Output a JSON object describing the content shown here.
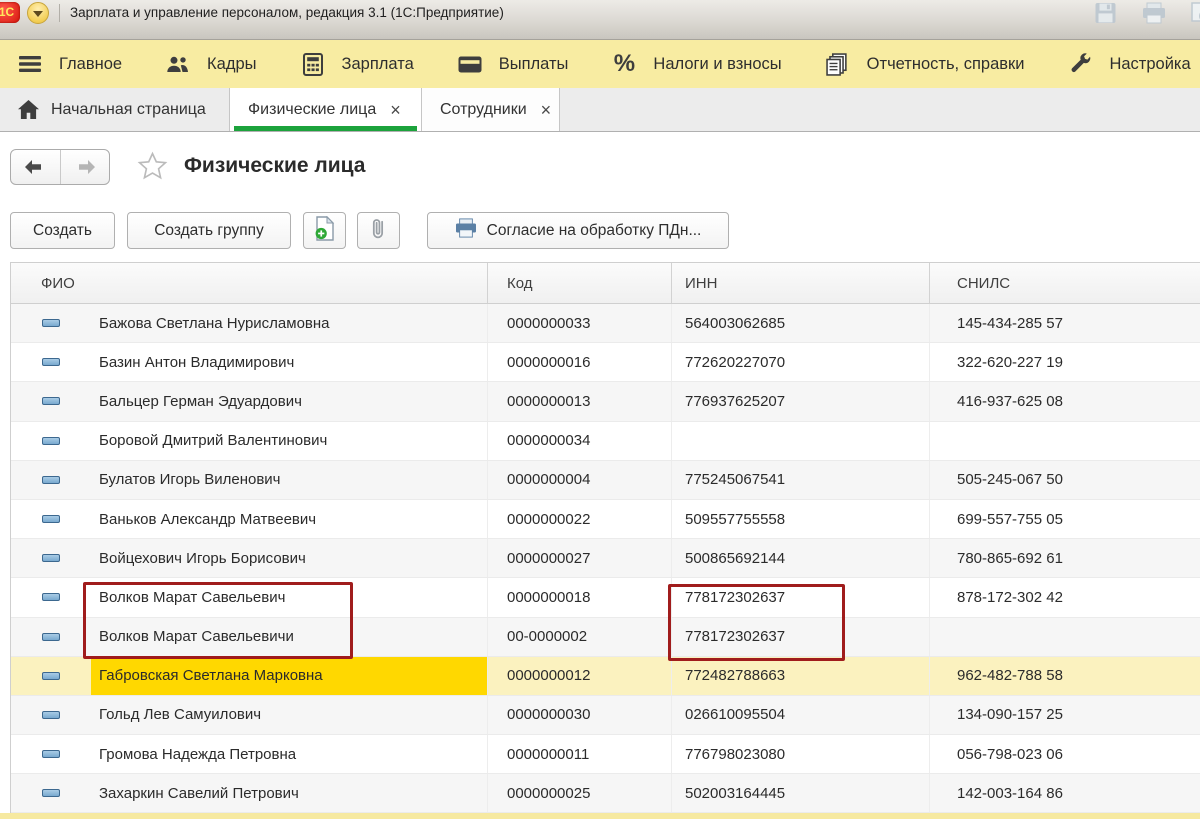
{
  "titlebar": {
    "logo": "1С",
    "title": "Зарплата и управление персоналом, редакция 3.1  (1С:Предприятие)",
    "window_icons": [
      "save-icon",
      "print-icon",
      "print-preview-icon"
    ]
  },
  "menu": {
    "items": [
      {
        "label": "Главное",
        "icon": "hamburger-icon"
      },
      {
        "label": "Кадры",
        "icon": "people-icon"
      },
      {
        "label": "Зарплата",
        "icon": "calculator-icon"
      },
      {
        "label": "Выплаты",
        "icon": "card-icon"
      },
      {
        "label": "Налоги и взносы",
        "icon": "percent-icon"
      },
      {
        "label": "Отчетность, справки",
        "icon": "report-icon"
      },
      {
        "label": "Настройка",
        "icon": "wrench-icon"
      }
    ]
  },
  "tabs": [
    {
      "label": "Начальная страница",
      "icon": "home-icon",
      "closable": false,
      "active": false
    },
    {
      "label": "Физические лица",
      "icon": null,
      "closable": true,
      "active": true
    },
    {
      "label": "Сотрудники",
      "icon": null,
      "closable": true,
      "active": false
    }
  ],
  "ui": {
    "close_glyph": "×"
  },
  "page": {
    "title": "Физические лица"
  },
  "toolbar": {
    "create_label": "Создать",
    "create_group_label": "Создать группу",
    "doc_plus_icon": "document-add-icon",
    "paperclip_icon": "paperclip-icon",
    "consent_label": "Согласие на обработку ПДн...",
    "consent_icon": "printer-icon"
  },
  "table": {
    "columns": [
      "ФИО",
      "Код",
      "ИНН",
      "СНИЛС"
    ],
    "rows": [
      {
        "fio": "Бажова Светлана Нурисламовна",
        "code": "0000000033",
        "inn": "564003062685",
        "snils": "145-434-285 57",
        "selected": false
      },
      {
        "fio": "Базин Антон Владимирович",
        "code": "0000000016",
        "inn": "772620227070",
        "snils": "322-620-227 19",
        "selected": false
      },
      {
        "fio": "Бальцер Герман Эдуардович",
        "code": "0000000013",
        "inn": "776937625207",
        "snils": "416-937-625 08",
        "selected": false
      },
      {
        "fio": "Боровой Дмитрий Валентинович",
        "code": "0000000034",
        "inn": "",
        "snils": "",
        "selected": false
      },
      {
        "fio": "Булатов Игорь Виленович",
        "code": "0000000004",
        "inn": "775245067541",
        "snils": "505-245-067 50",
        "selected": false
      },
      {
        "fio": "Ваньков Александр Матвеевич",
        "code": "0000000022",
        "inn": "509557755558",
        "snils": "699-557-755 05",
        "selected": false
      },
      {
        "fio": "Войцехович Игорь Борисович",
        "code": "0000000027",
        "inn": "500865692144",
        "snils": "780-865-692 61",
        "selected": false
      },
      {
        "fio": "Волков Марат Савельевич",
        "code": "0000000018",
        "inn": "778172302637",
        "snils": "878-172-302 42",
        "selected": false
      },
      {
        "fio": "Волков Марат Савельевичи",
        "code": "00-0000002",
        "inn": "778172302637",
        "snils": "",
        "selected": false
      },
      {
        "fio": "Габровская Светлана Марковна",
        "code": "0000000012",
        "inn": "772482788663",
        "snils": "962-482-788 58",
        "selected": true
      },
      {
        "fio": "Гольд Лев Самуилович",
        "code": "0000000030",
        "inn": "026610095504",
        "snils": "134-090-157 25",
        "selected": false
      },
      {
        "fio": "Громова Надежда Петровна",
        "code": "0000000011",
        "inn": "776798023080",
        "snils": "056-798-023 06",
        "selected": false
      },
      {
        "fio": "Захаркин Савелий Петрович",
        "code": "0000000025",
        "inn": "502003164445",
        "snils": "142-003-164 86",
        "selected": false
      }
    ]
  },
  "annotations": {
    "color": "#a01c1c",
    "boxes": [
      "duplicate-fio-rows-8-9",
      "duplicate-inn-rows-8-9"
    ]
  },
  "colors": {
    "menu_background": "#f8eca2",
    "active_tab_underline": "#1ca33c",
    "selected_row": "#fbf2bf",
    "selected_cell": "#ffd800",
    "annotation_red": "#a01c1c"
  }
}
